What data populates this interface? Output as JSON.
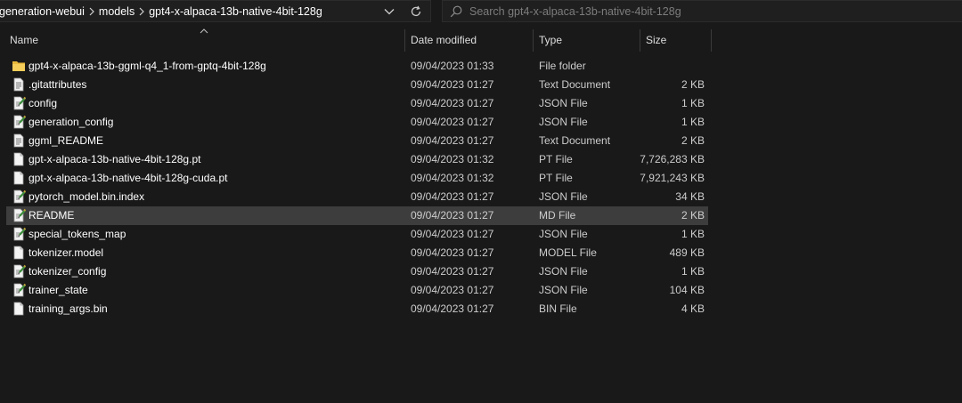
{
  "address": {
    "breadcrumbs": [
      "generation-webui",
      "models",
      "gpt4-x-alpaca-13b-native-4bit-128g"
    ]
  },
  "search": {
    "placeholder": "Search gpt4-x-alpaca-13b-native-4bit-128g"
  },
  "columns": {
    "name": "Name",
    "date": "Date modified",
    "type": "Type",
    "size": "Size"
  },
  "files": [
    {
      "name": "gpt4-x-alpaca-13b-ggml-q4_1-from-gptq-4bit-128g",
      "date": "09/04/2023 01:33",
      "type": "File folder",
      "size": "",
      "icon": "folder-icon"
    },
    {
      "name": ".gitattributes",
      "date": "09/04/2023 01:27",
      "type": "Text Document",
      "size": "2 KB",
      "icon": "text-file-icon"
    },
    {
      "name": "config",
      "date": "09/04/2023 01:27",
      "type": "JSON File",
      "size": "1 KB",
      "icon": "json-file-icon"
    },
    {
      "name": "generation_config",
      "date": "09/04/2023 01:27",
      "type": "JSON File",
      "size": "1 KB",
      "icon": "json-file-icon"
    },
    {
      "name": "ggml_README",
      "date": "09/04/2023 01:27",
      "type": "Text Document",
      "size": "2 KB",
      "icon": "text-file-icon"
    },
    {
      "name": "gpt-x-alpaca-13b-native-4bit-128g.pt",
      "date": "09/04/2023 01:32",
      "type": "PT File",
      "size": "7,726,283 KB",
      "icon": "blank-file-icon"
    },
    {
      "name": "gpt-x-alpaca-13b-native-4bit-128g-cuda.pt",
      "date": "09/04/2023 01:32",
      "type": "PT File",
      "size": "7,921,243 KB",
      "icon": "blank-file-icon"
    },
    {
      "name": "pytorch_model.bin.index",
      "date": "09/04/2023 01:27",
      "type": "JSON File",
      "size": "34 KB",
      "icon": "json-file-icon"
    },
    {
      "name": "README",
      "date": "09/04/2023 01:27",
      "type": "MD File",
      "size": "2 KB",
      "icon": "json-file-icon",
      "selected": true
    },
    {
      "name": "special_tokens_map",
      "date": "09/04/2023 01:27",
      "type": "JSON File",
      "size": "1 KB",
      "icon": "json-file-icon"
    },
    {
      "name": "tokenizer.model",
      "date": "09/04/2023 01:27",
      "type": "MODEL File",
      "size": "489 KB",
      "icon": "blank-file-icon"
    },
    {
      "name": "tokenizer_config",
      "date": "09/04/2023 01:27",
      "type": "JSON File",
      "size": "1 KB",
      "icon": "json-file-icon"
    },
    {
      "name": "trainer_state",
      "date": "09/04/2023 01:27",
      "type": "JSON File",
      "size": "104 KB",
      "icon": "json-file-icon"
    },
    {
      "name": "training_args.bin",
      "date": "09/04/2023 01:27",
      "type": "BIN File",
      "size": "4 KB",
      "icon": "blank-file-icon"
    }
  ]
}
